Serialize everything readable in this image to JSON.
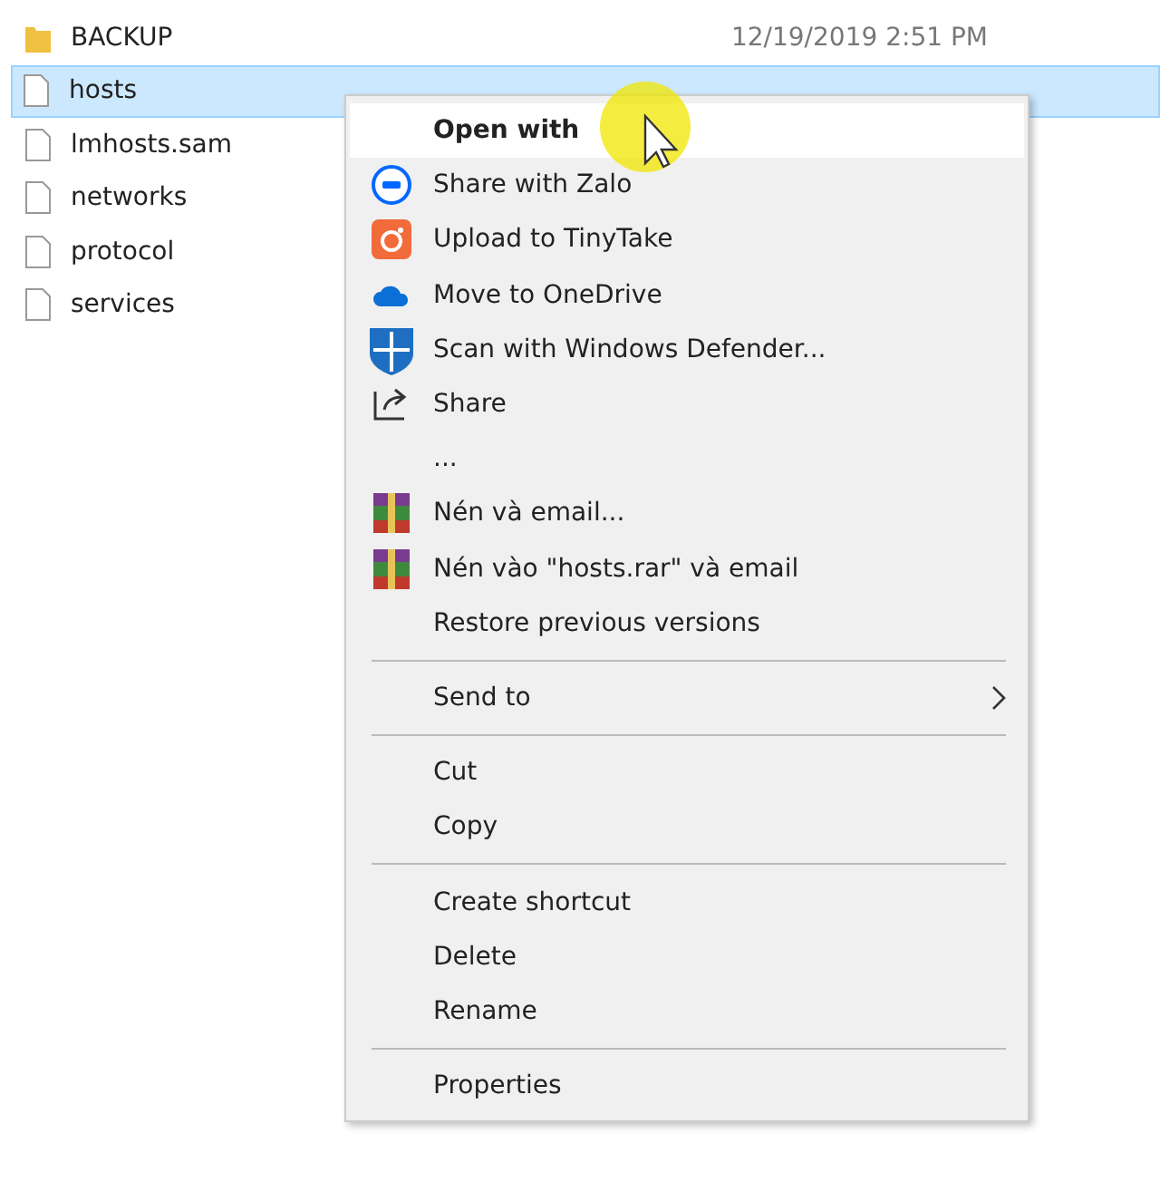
{
  "files": [
    {
      "name": "BACKUP",
      "kind": "folder",
      "selected": false,
      "modified": "12/19/2019 2:51 PM"
    },
    {
      "name": "hosts",
      "kind": "file",
      "selected": true
    },
    {
      "name": "lmhosts.sam",
      "kind": "file",
      "selected": false
    },
    {
      "name": "networks",
      "kind": "file",
      "selected": false
    },
    {
      "name": "protocol",
      "kind": "file",
      "selected": false
    },
    {
      "name": "services",
      "kind": "file",
      "selected": false
    }
  ],
  "context_menu": [
    {
      "kind": "default",
      "label": "Open with",
      "selected": true
    },
    {
      "kind": "zalo",
      "label": "Share with Zalo"
    },
    {
      "kind": "tinytake",
      "label": "Upload to TinyTake"
    },
    {
      "kind": "onedrive",
      "label": "Move to OneDrive"
    },
    {
      "kind": "defender",
      "label": "Scan with Windows Defender..."
    },
    {
      "kind": "share",
      "label": "Share"
    },
    {
      "kind": "plain",
      "label": "..."
    },
    {
      "kind": "winrar",
      "label": "Nén và email..."
    },
    {
      "kind": "winrar",
      "label": "Nén vào \"hosts.rar\" và email"
    },
    {
      "kind": "plain",
      "label": "Restore previous versions"
    },
    {
      "kind": "separator"
    },
    {
      "kind": "submenu",
      "label": "Send to"
    },
    {
      "kind": "separator"
    },
    {
      "kind": "plain",
      "label": "Cut"
    },
    {
      "kind": "plain",
      "label": "Copy"
    },
    {
      "kind": "separator"
    },
    {
      "kind": "plain",
      "label": "Create shortcut"
    },
    {
      "kind": "plain",
      "label": "Delete"
    },
    {
      "kind": "plain",
      "label": "Rename"
    },
    {
      "kind": "separator"
    },
    {
      "kind": "plain",
      "label": "Properties"
    }
  ]
}
